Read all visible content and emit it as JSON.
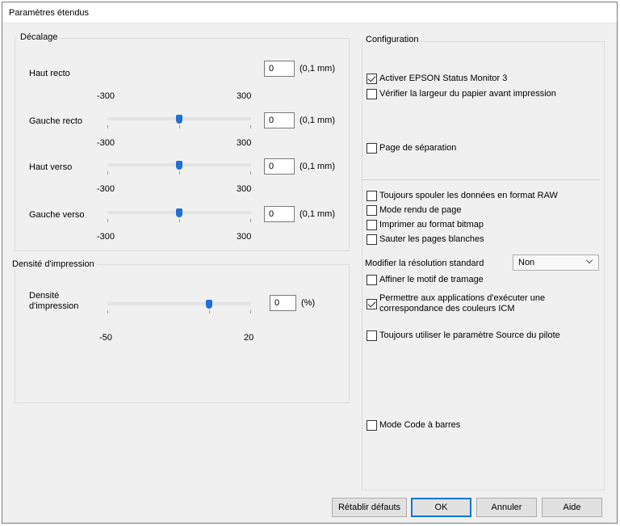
{
  "window": {
    "title": "Paramètres étendus"
  },
  "decalage": {
    "title": "Décalage",
    "rows": [
      {
        "label": "Haut recto",
        "value": "0",
        "unit": "(0,1 mm)",
        "min": "-300",
        "max": "300",
        "slider_fraction": 0.5,
        "show_slider": false
      },
      {
        "label": "Gauche recto",
        "value": "0",
        "unit": "(0,1 mm)",
        "min": "-300",
        "max": "300",
        "slider_fraction": 0.5,
        "show_slider": true
      },
      {
        "label": "Haut verso",
        "value": "0",
        "unit": "(0,1 mm)",
        "min": "-300",
        "max": "300",
        "slider_fraction": 0.5,
        "show_slider": true
      },
      {
        "label": "Gauche verso",
        "value": "0",
        "unit": "(0,1 mm)",
        "min": "-300",
        "max": "300",
        "slider_fraction": 0.5,
        "show_slider": true
      }
    ]
  },
  "densite": {
    "title": "Densité d'impression",
    "label_line1": "Densité",
    "label_line2": "d'impression",
    "value": "0",
    "unit": "(%)",
    "min": "-50",
    "max": "20",
    "slider_fraction": 0.714
  },
  "configuration": {
    "title": "Configuration",
    "status_monitor": {
      "label": "Activer EPSON Status Monitor 3",
      "checked": true
    },
    "verify_width": {
      "label": "Vérifier la largeur du papier avant impression",
      "checked": false
    },
    "separator_page": {
      "label": "Page de séparation",
      "checked": false
    },
    "spool_raw": {
      "label": "Toujours spouler les données en format RAW",
      "checked": false
    },
    "page_render": {
      "label": "Mode rendu de page",
      "checked": false
    },
    "bitmap": {
      "label": "Imprimer au format bitmap",
      "checked": false
    },
    "skip_blank": {
      "label": "Sauter les pages blanches",
      "checked": false
    },
    "resolution": {
      "label": "Modifier la résolution standard",
      "selected": "Non"
    },
    "refine": {
      "label": "Affiner le motif de tramage",
      "checked": false
    },
    "icm": {
      "line1": "Permettre aux applications d'exécuter une",
      "line2": "correspondance des couleurs ICM",
      "checked": true
    },
    "source": {
      "label": "Toujours utiliser le paramètre Source du pilote",
      "checked": false
    },
    "barcode": {
      "label": "Mode Code à barres",
      "checked": false
    }
  },
  "buttons": {
    "reset": "Rétablir défauts",
    "ok": "OK",
    "cancel": "Annuler",
    "help": "Aide"
  },
  "colors": {
    "accent": "#0078d7",
    "slider_thumb": "#1f6fd6"
  }
}
